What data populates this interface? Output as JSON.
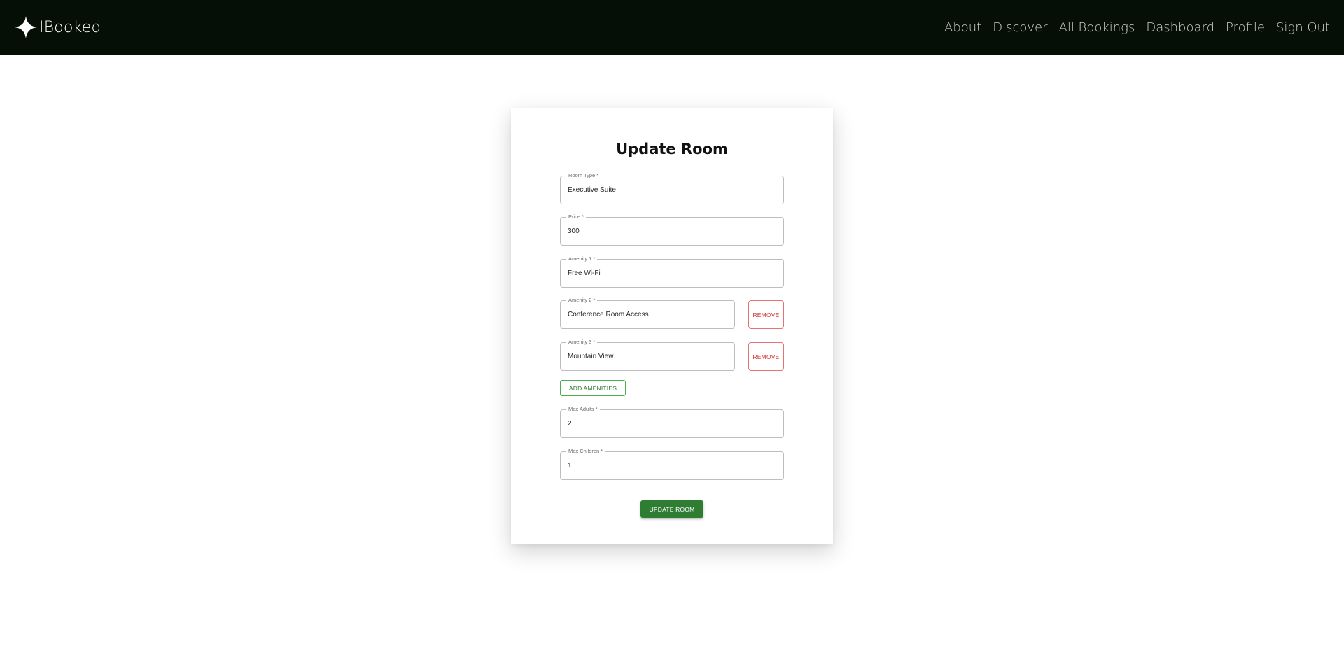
{
  "brand": {
    "name": "IBooked"
  },
  "nav": {
    "about": "About",
    "discover": "Discover",
    "all_bookings": "All Bookings",
    "dashboard": "Dashboard",
    "profile": "Profile",
    "sign_out": "Sign Out"
  },
  "form": {
    "title": "Update Room",
    "room_type": {
      "label": "Room Type *",
      "value": "Executive Suite"
    },
    "price": {
      "label": "Price *",
      "value": "300"
    },
    "amenities": [
      {
        "label": "Amenity 1 *",
        "value": "Free Wi-Fi"
      },
      {
        "label": "Amenity 2 *",
        "value": "Conference Room Access"
      },
      {
        "label": "Amenity 3 *",
        "value": "Mountain View"
      }
    ],
    "remove_label": "REMOVE",
    "add_amenities_label": "ADD AMENITIES",
    "max_adults": {
      "label": "Max Adults *",
      "value": "2"
    },
    "max_children": {
      "label": "Max Children *",
      "value": "1"
    },
    "submit_label": "UPDATE ROOM"
  },
  "colors": {
    "navbar_bg": "#050f05",
    "primary_green": "#2e7d32",
    "remove_red": "#d32f2f"
  },
  "icons": {
    "logo": "four-point-star-icon"
  }
}
